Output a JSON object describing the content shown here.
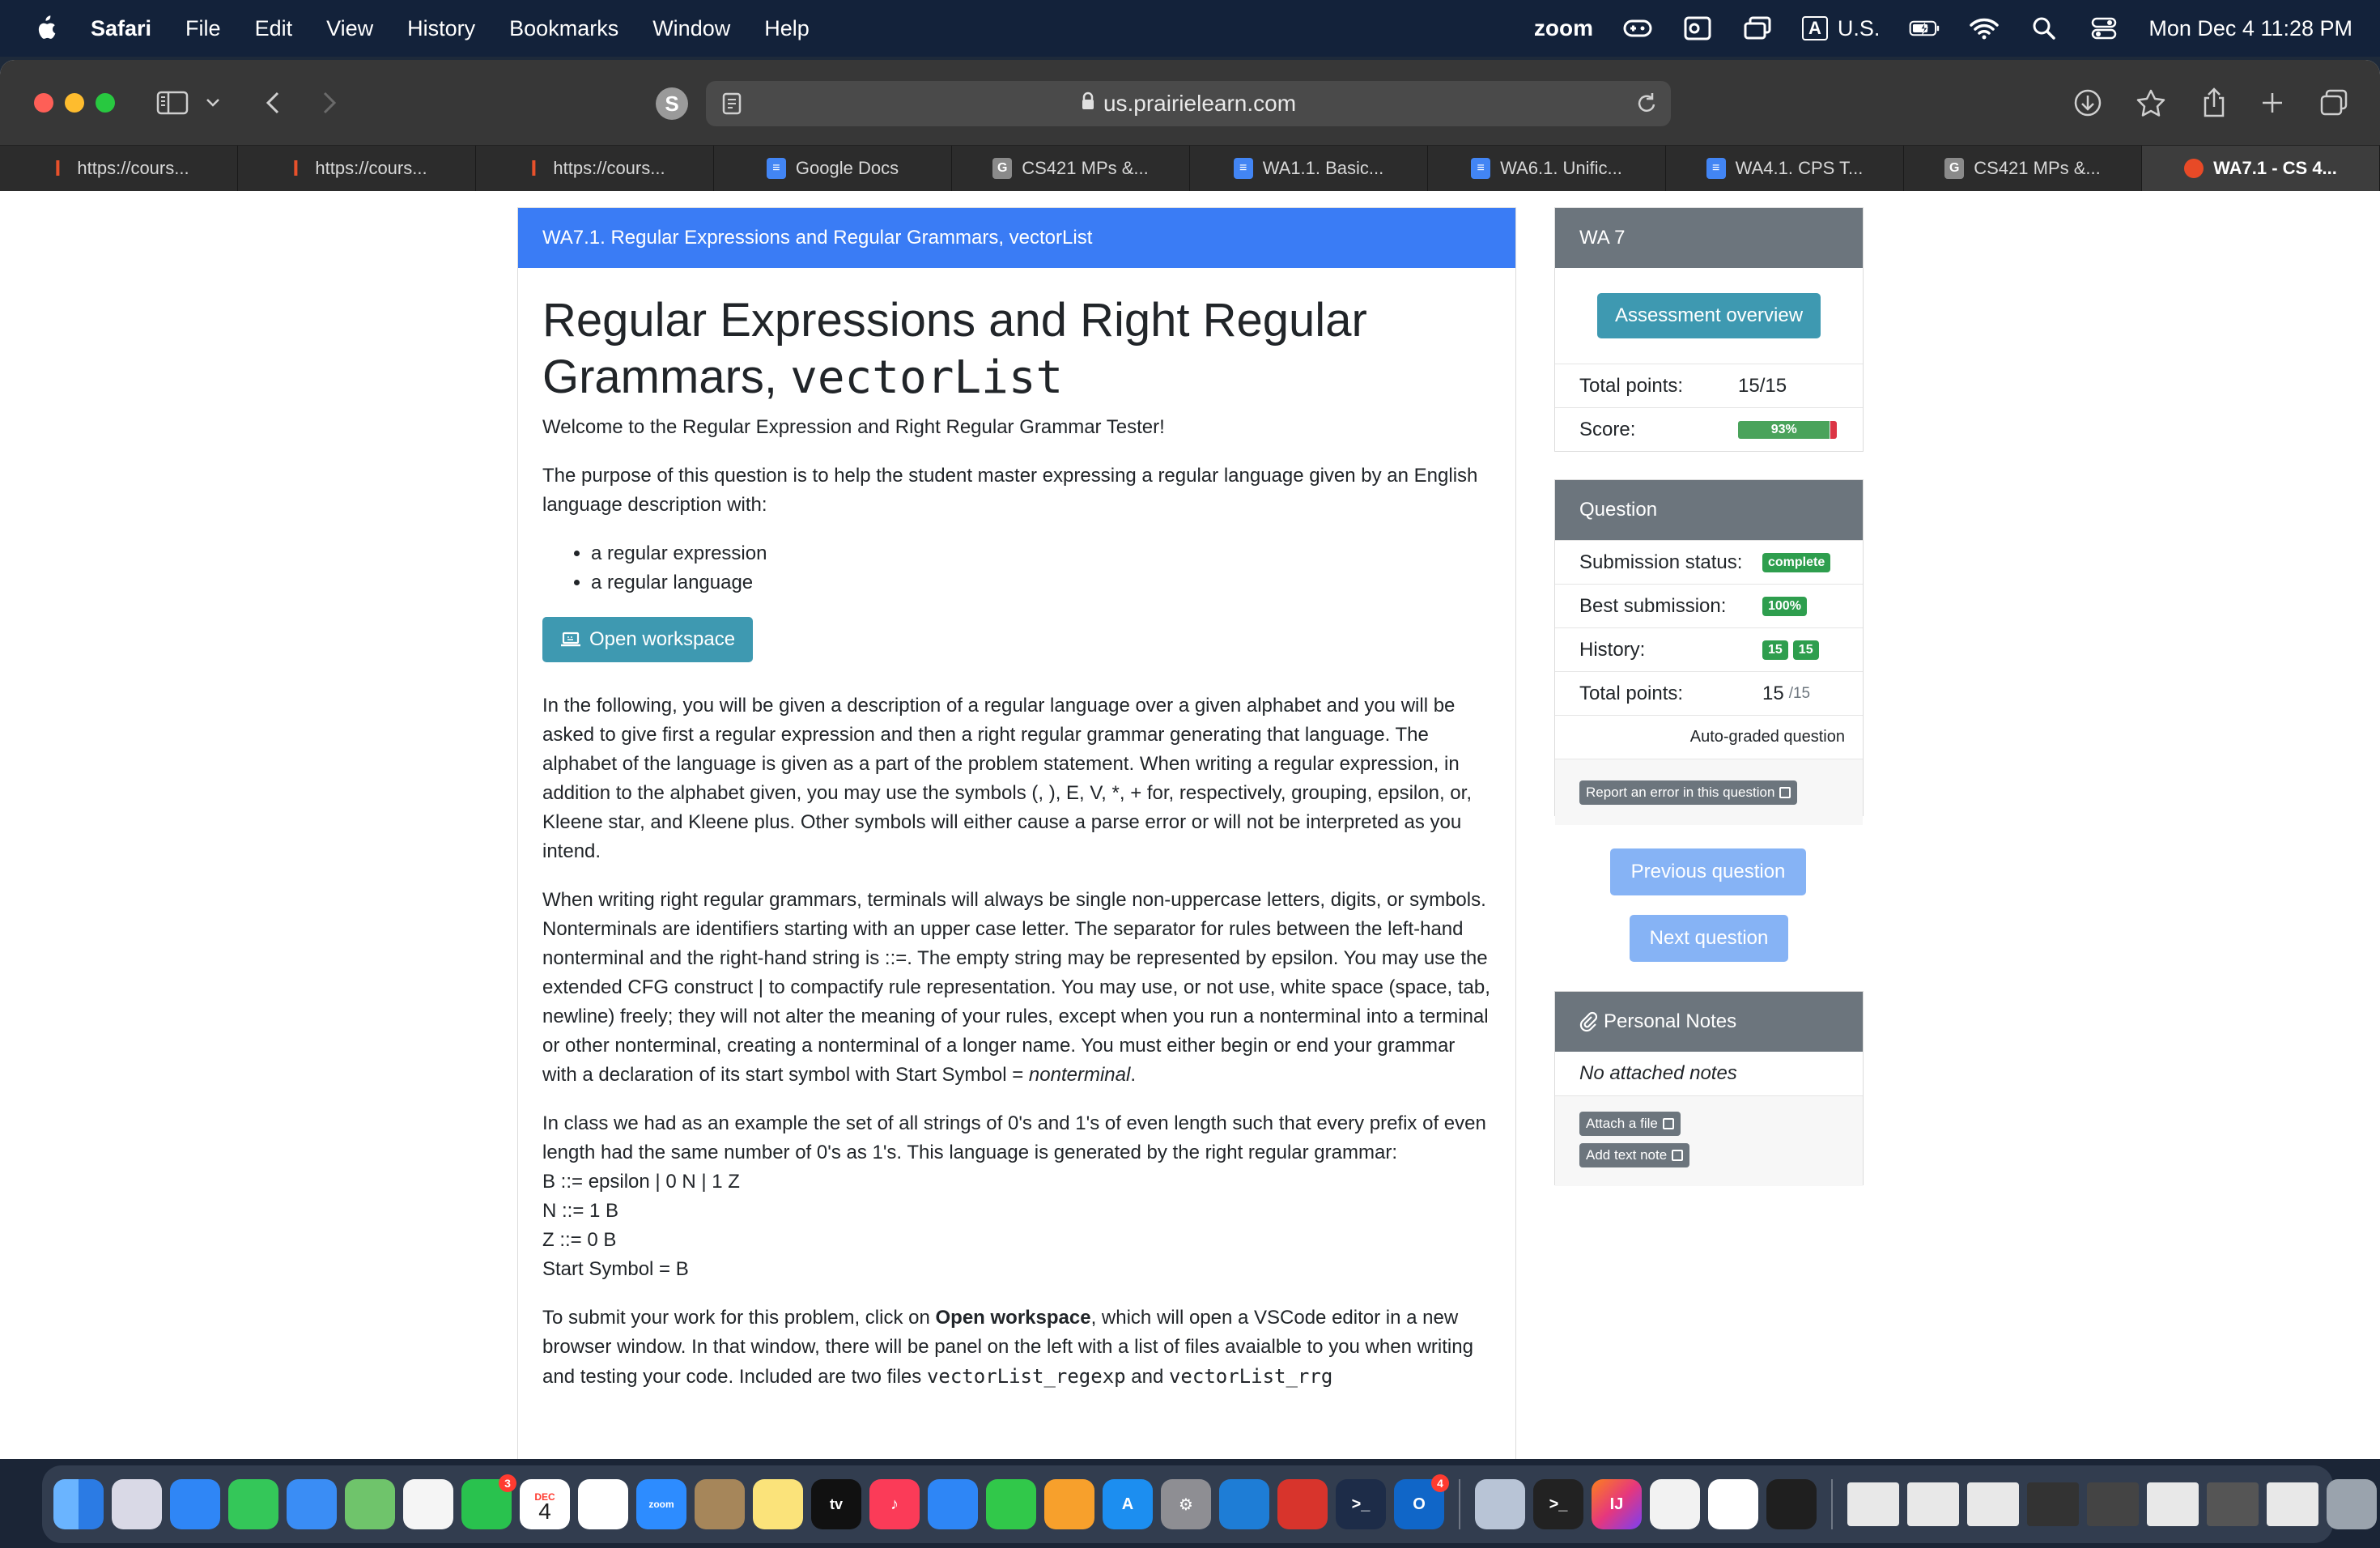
{
  "menubar": {
    "app_name": "Safari",
    "menus": [
      "File",
      "Edit",
      "View",
      "History",
      "Bookmarks",
      "Window",
      "Help"
    ],
    "zoom_label": "zoom",
    "input_source": "U.S.",
    "input_letter": "A",
    "datetime": "Mon Dec 4  11:28 PM"
  },
  "browser": {
    "url": "us.prairielearn.com",
    "profile_letter": "S",
    "tabs": [
      {
        "label": "https://cours...",
        "favicon": "illinois-icon"
      },
      {
        "label": "https://cours...",
        "favicon": "illinois-icon"
      },
      {
        "label": "https://cours...",
        "favicon": "illinois-icon"
      },
      {
        "label": "Google Docs",
        "favicon": "docs-icon"
      },
      {
        "label": "CS421 MPs &...",
        "favicon": "g-icon"
      },
      {
        "label": "WA1.1. Basic...",
        "favicon": "docs-icon"
      },
      {
        "label": "WA6.1. Unific...",
        "favicon": "docs-icon"
      },
      {
        "label": "WA4.1. CPS T...",
        "favicon": "docs-icon"
      },
      {
        "label": "CS421 MPs &...",
        "favicon": "g-icon"
      },
      {
        "label": "WA7.1 - CS 4...",
        "favicon": "prairielearn-icon"
      }
    ]
  },
  "question": {
    "header": "WA7.1. Regular Expressions and Regular Grammars, vectorList",
    "title_text": "Regular Expressions and Right Regular Grammars, ",
    "title_code": "vectorList",
    "welcome": "Welcome to the Regular Expression and Right Regular Grammar Tester!",
    "purpose": "The purpose of this question is to help the student master expressing a regular language given by an English language description with:",
    "bullets": [
      "a regular expression",
      "a regular language"
    ],
    "open_workspace": "Open workspace",
    "para1": "In the following, you will be given a description of a regular language over a given alphabet and you will be asked to give first a regular expression and then a right regular grammar generating that language. The alphabet of the language is given as a part of the problem statement. When writing a regular expression, in addition to the alphabet given, you may use the symbols (, ), E, V, *, + for, respectively, grouping, epsilon, or, Kleene star, and Kleene plus. Other symbols will either cause a parse error or will not be interpreted as you intend.",
    "para2_main": "When writing right regular grammars, terminals will always be single non-uppercase letters, digits, or symbols. Nonterminals are identifiers starting with an upper case letter. The separator for rules between the left-hand nonterminal and the right-hand string is ::=. The empty string may be represented by epsilon. You may use the extended CFG construct | to compactify rule representation. You may use, or not use, white space (space, tab, newline) freely; they will not alter the meaning of your rules, except when you run a nonterminal into a terminal or other nonterminal, creating a nonterminal of a longer name. You must either begin or end your grammar with a declaration of its start symbol with Start Symbol = ",
    "para2_em": "nonterminal",
    "para2_end": ".",
    "para3": "In class we had as an example the set of all strings of 0's and 1's of even length such that every prefix of even length had the same number of 0's as 1's. This language is generated by the right regular grammar:",
    "grammar": [
      "B ::= epsilon | 0 N | 1 Z",
      "N ::= 1 B",
      "Z ::= 0 B",
      "Start Symbol = B"
    ],
    "para4_a": "To submit your work for this problem, click on ",
    "para4_b": "Open workspace",
    "para4_c": ", which will open a VSCode editor in a new browser window. In that window, there will be panel on the left with a list of files avaialble to you when writing and testing your code. Included are two files ",
    "para4_code1": "vectorList_regexp",
    "para4_d": " and ",
    "para4_code2": "vectorList_rrg"
  },
  "assessment": {
    "header": "WA 7",
    "overview_button": "Assessment overview",
    "total_points_label": "Total points:",
    "total_points_value": "15/15",
    "score_label": "Score:",
    "score_text": "93%",
    "score_fraction": 0.93
  },
  "question_panel": {
    "header": "Question",
    "submission_status_label": "Submission status:",
    "submission_status_value": "complete",
    "best_submission_label": "Best submission:",
    "best_submission_value": "100%",
    "history_label": "History:",
    "history_values": [
      "15",
      "15"
    ],
    "total_points_label": "Total points:",
    "total_points_value": "15",
    "total_points_max": "/15",
    "graded_note": "Auto-graded question",
    "report_button": "Report an error in this question"
  },
  "navigation": {
    "previous": "Previous question",
    "next": "Next question"
  },
  "notes": {
    "header": "Personal Notes",
    "empty_text": "No attached notes",
    "attach_file": "Attach a file",
    "add_text_note": "Add text note"
  },
  "dock": {
    "badges": {
      "facetime": "3",
      "calendar_month": "DEC",
      "calendar_day": "4",
      "outlook": "4"
    }
  },
  "colors": {
    "accent_blue": "#3a7cf5",
    "teal": "#3e99b1",
    "panel_gray": "#6c757d",
    "success_green": "#2e9e4e"
  }
}
